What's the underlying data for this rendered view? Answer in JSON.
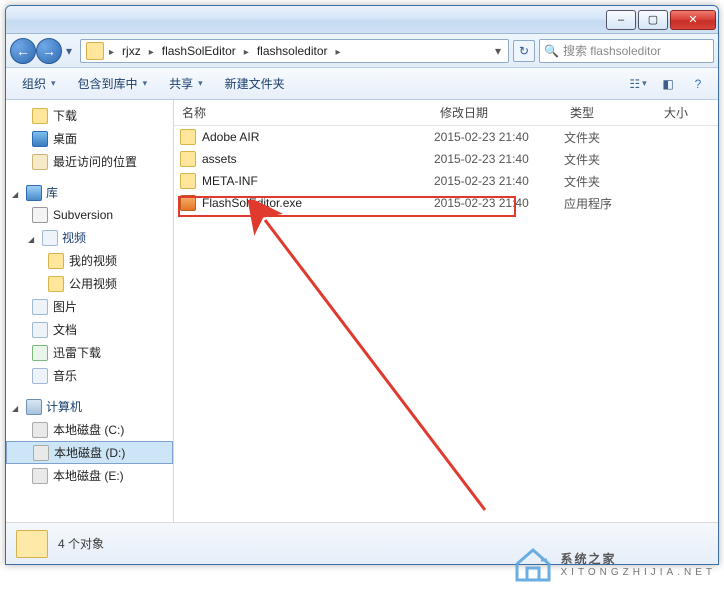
{
  "titlebar": {
    "min": "–",
    "max": "▢",
    "close": "✕"
  },
  "nav": {
    "back": "←",
    "forward": "→",
    "dd": "▾",
    "refresh": "↻"
  },
  "breadcrumb": [
    "rjxz",
    "flashSolEditor",
    "flashsoleditor"
  ],
  "search": {
    "placeholder": "搜索 flashsoleditor"
  },
  "toolbar": {
    "organize": "组织",
    "include": "包含到库中",
    "share": "共享",
    "newfolder": "新建文件夹"
  },
  "navpane": {
    "downloads": "下载",
    "desktop": "桌面",
    "recent": "最近访问的位置",
    "libraries": "库",
    "subversion": "Subversion",
    "videos": "视频",
    "myvideos": "我的视频",
    "publicvideos": "公用视频",
    "pictures": "图片",
    "documents": "文档",
    "xunlei": "迅雷下载",
    "music": "音乐",
    "computer": "计算机",
    "drive_c": "本地磁盘 (C:)",
    "drive_d": "本地磁盘 (D:)",
    "drive_e": "本地磁盘 (E:)"
  },
  "columns": {
    "name": "名称",
    "date": "修改日期",
    "type": "类型",
    "size": "大小"
  },
  "files": [
    {
      "name": "Adobe AIR",
      "date": "2015-02-23 21:40",
      "type": "文件夹",
      "icon": "folder"
    },
    {
      "name": "assets",
      "date": "2015-02-23 21:40",
      "type": "文件夹",
      "icon": "folder"
    },
    {
      "name": "META-INF",
      "date": "2015-02-23 21:40",
      "type": "文件夹",
      "icon": "folder"
    },
    {
      "name": "FlashSolEditor.exe",
      "date": "2015-02-23 21:40",
      "type": "应用程序",
      "icon": "exe"
    }
  ],
  "status": {
    "count": "4 个对象"
  },
  "watermark": {
    "main": "系统之家",
    "sub": "XITONGZHIJIA.NET"
  }
}
